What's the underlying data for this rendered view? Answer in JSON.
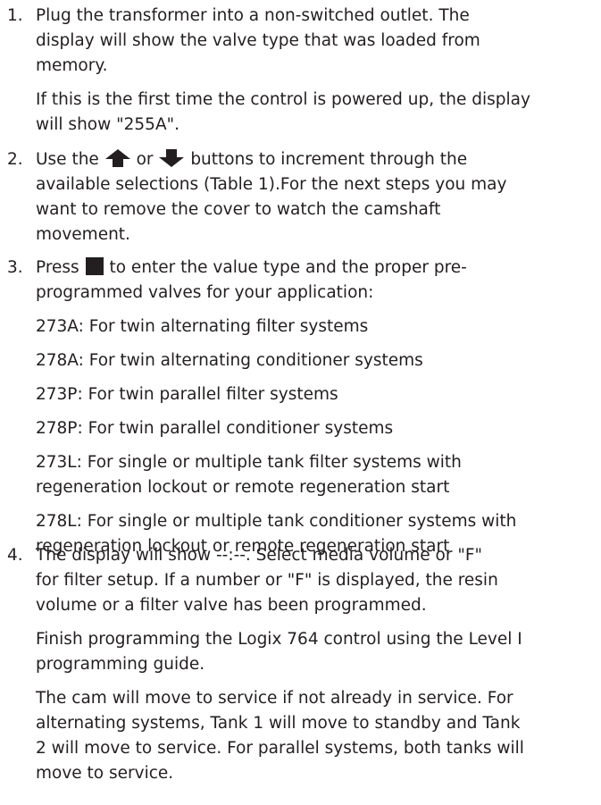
{
  "steps": [
    {
      "number": "1.",
      "paragraphs": [
        [
          "Plug the transformer into a non-switched outlet. The",
          "display will show the valve type that was loaded from",
          "memory."
        ],
        [
          "If this is the first time the control is powered up, the display",
          "will show \"255A\"."
        ]
      ]
    },
    {
      "number": "2.",
      "line1": {
        "before": "Use the",
        "between": "or",
        "after": "buttons to increment through the"
      },
      "lines": [
        "available selections (Table 1).For the next steps you may",
        "want to remove the cover to watch the camshaft",
        "movement."
      ]
    },
    {
      "number": "3.",
      "line1": {
        "before": "Press",
        "after": "to enter the value type and the proper pre-"
      },
      "line2": "programmed valves for your application:",
      "options": [
        [
          "273A:  For twin alternating filter systems"
        ],
        [
          "278A:  For twin alternating conditioner systems"
        ],
        [
          "273P: For twin parallel filter systems"
        ],
        [
          "278P: For twin parallel conditioner systems"
        ],
        [
          "273L: For single or multiple tank filter systems with",
          "regeneration lockout or remote regeneration start"
        ],
        [
          "278L: For single or multiple tank conditioner systems with",
          "regeneration lockout or remote regeneration start"
        ]
      ]
    },
    {
      "number": "4.",
      "paragraphs": [
        [
          "The display will show --:--. Select media volume or \"F\"",
          "for filter setup. If a number or \"F\" is displayed, the resin",
          "volume or a filter valve has been programmed."
        ],
        [
          "Finish programming the Logix 764 control using the Level I",
          "programming guide."
        ],
        [
          "The cam will move to service if not already in service. For",
          "alternating systems, Tank 1 will move to standby and Tank",
          "2 will move to service. For parallel systems, both tanks will",
          "move to service."
        ]
      ]
    }
  ],
  "icons": {
    "up": "up-arrow-button-icon",
    "down": "down-arrow-button-icon",
    "enter": "enter-square-button-icon"
  }
}
